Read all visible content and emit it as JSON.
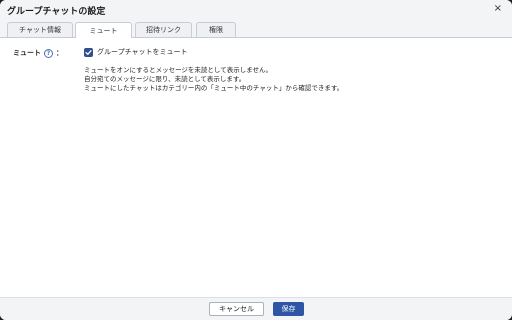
{
  "dialog": {
    "title": "グループチャットの設定",
    "close_glyph": "×"
  },
  "tabs": [
    {
      "label": "チャット情報",
      "active": false
    },
    {
      "label": "ミュート",
      "active": true
    },
    {
      "label": "招待リンク",
      "active": false
    },
    {
      "label": "権限",
      "active": false
    }
  ],
  "mute": {
    "label": "ミュート",
    "help_glyph": "?",
    "colon": "：",
    "checkbox_label": "グループチャットをミュート",
    "checked": true,
    "description": [
      "ミュートをオンにするとメッセージを未読として表示しません。",
      "自分宛てのメッセージに限り、未読として表示します。",
      "ミュートにしたチャットはカテゴリー内の「ミュート中のチャット」から確認できます。"
    ]
  },
  "footer": {
    "cancel_label": "キャンセル",
    "save_label": "保存"
  },
  "colors": {
    "accent": "#2e55a6",
    "checkbox": "#2f4f8f"
  }
}
